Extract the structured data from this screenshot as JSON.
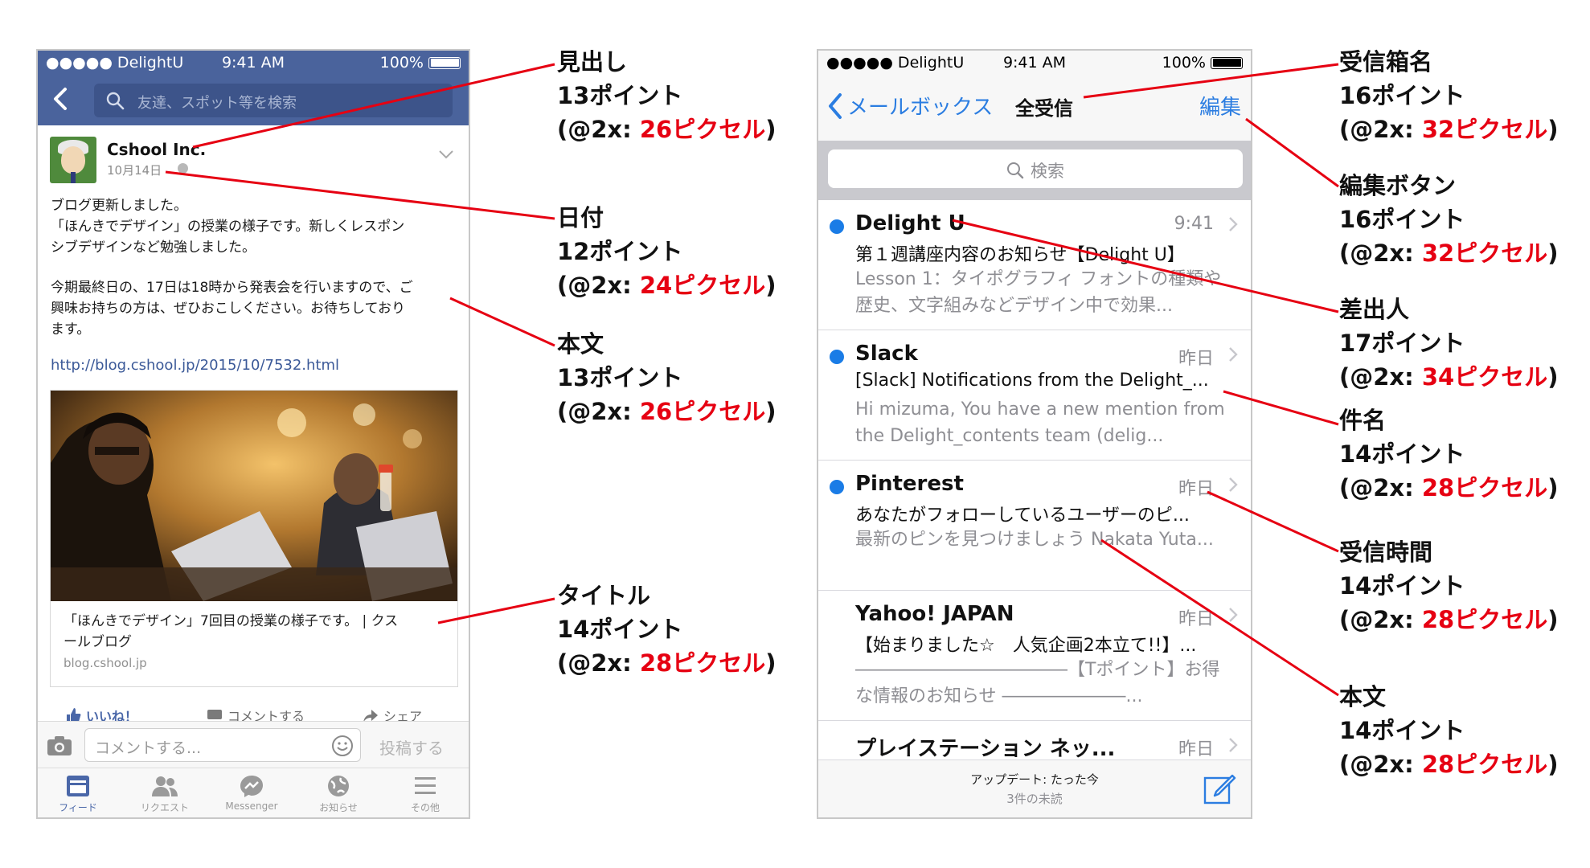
{
  "facebook": {
    "status": {
      "carrier": "●●●●● DelightU",
      "time": "9:41 AM",
      "battery": "100%"
    },
    "search_placeholder": "友達、スポット等を検索",
    "post": {
      "author": "Cshool Inc.",
      "date": "10月14日",
      "body_lines_1": [
        "ブログ更新しました。",
        "「ほんきでデザイン」の授業の様子です。新しくレスポン",
        "シブデザインなど勉強しました。"
      ],
      "body_lines_2": [
        "今期最終日の、17日は18時から発表会を行いますので、ご",
        "興味お持ちの方は、ぜひおこしください。お待ちしており",
        "ます。"
      ],
      "link": "http://blog.cshool.jp/2015/10/7532.html",
      "card_title_1": "「ほんきでデザイン」7回目の授業の様子です。 | クス",
      "card_title_2": "ールブログ",
      "card_domain": "blog.cshool.jp"
    },
    "actions": {
      "like": "いいね！",
      "comment": "コメントする",
      "share": "シェア"
    },
    "comment_placeholder": "コメントする...",
    "post_button": "投稿する",
    "tabs": [
      "フィード",
      "リクエスト",
      "Messenger",
      "お知らせ",
      "その他"
    ],
    "accent": "#4a639c"
  },
  "mail": {
    "status": {
      "carrier": "●●●●● DelightU",
      "time": "9:41 AM",
      "battery": "100%"
    },
    "back_label": "メールボックス",
    "title": "全受信",
    "edit_label": "編集",
    "search_placeholder": "検索",
    "messages": [
      {
        "sender": "Delight U",
        "time": "9:41",
        "subject": "第１週講座内容のお知らせ【Delight U】",
        "preview": "Lesson 1：タイポグラフィ フォントの種類や歴史、文字組みなどデザイン中で効果...",
        "unread": true
      },
      {
        "sender": "Slack",
        "time": "昨日",
        "subject": "[Slack] Notifications from the Delight_...",
        "preview": "Hi mizuma, You have a new mention from the Delight_contents team (delig...",
        "unread": true
      },
      {
        "sender": "Pinterest",
        "time": "昨日",
        "subject": "あなたがフォローしているユーザーのピ...",
        "preview": "最新のピンを見つけましょう Nakata Yuta...",
        "unread": true
      },
      {
        "sender": "Yahoo! JAPAN",
        "time": "昨日",
        "subject": "【始まりました☆　人気企画2本立て!!】...",
        "preview": "――――――――――――【Tポイント】お得な情報のお知らせ ―――――――...",
        "unread": false
      },
      {
        "sender": "プレイステーション ネッ...",
        "time": "昨日",
        "subject": "",
        "preview": "",
        "unread": false
      }
    ],
    "updated": "アップデート: たった今",
    "unread_count": "3件の未読",
    "accent": "#2b7de1"
  },
  "annotations": [
    {
      "name": "見出し",
      "points": "13ポイント",
      "prefix": "(@2x: ",
      "pixels": "26ピクセル",
      "suffix": ")"
    },
    {
      "name": "日付",
      "points": "12ポイント",
      "prefix": "(@2x: ",
      "pixels": "24ピクセル",
      "suffix": ")"
    },
    {
      "name": "本文",
      "points": "13ポイント",
      "prefix": "(@2x: ",
      "pixels": "26ピクセル",
      "suffix": ")"
    },
    {
      "name": "タイトル",
      "points": "14ポイント",
      "prefix": "(@2x: ",
      "pixels": "28ピクセル",
      "suffix": ")"
    },
    {
      "name": "受信箱名",
      "points": "16ポイント",
      "prefix": "(@2x: ",
      "pixels": "32ピクセル",
      "suffix": ")"
    },
    {
      "name": "編集ボタン",
      "points": "16ポイント",
      "prefix": "(@2x: ",
      "pixels": "32ピクセル",
      "suffix": ")"
    },
    {
      "name": "差出人",
      "points": "17ポイント",
      "prefix": "(@2x: ",
      "pixels": "34ピクセル",
      "suffix": ")"
    },
    {
      "name": "件名",
      "points": "14ポイント",
      "prefix": "(@2x: ",
      "pixels": "28ピクセル",
      "suffix": ")"
    },
    {
      "name": "受信時間",
      "points": "14ポイント",
      "prefix": "(@2x: ",
      "pixels": "28ピクセル",
      "suffix": ")"
    },
    {
      "name": "本文",
      "points": "14ポイント",
      "prefix": "(@2x: ",
      "pixels": "28ピクセル",
      "suffix": ")"
    }
  ],
  "annotation_color": "#e60012"
}
